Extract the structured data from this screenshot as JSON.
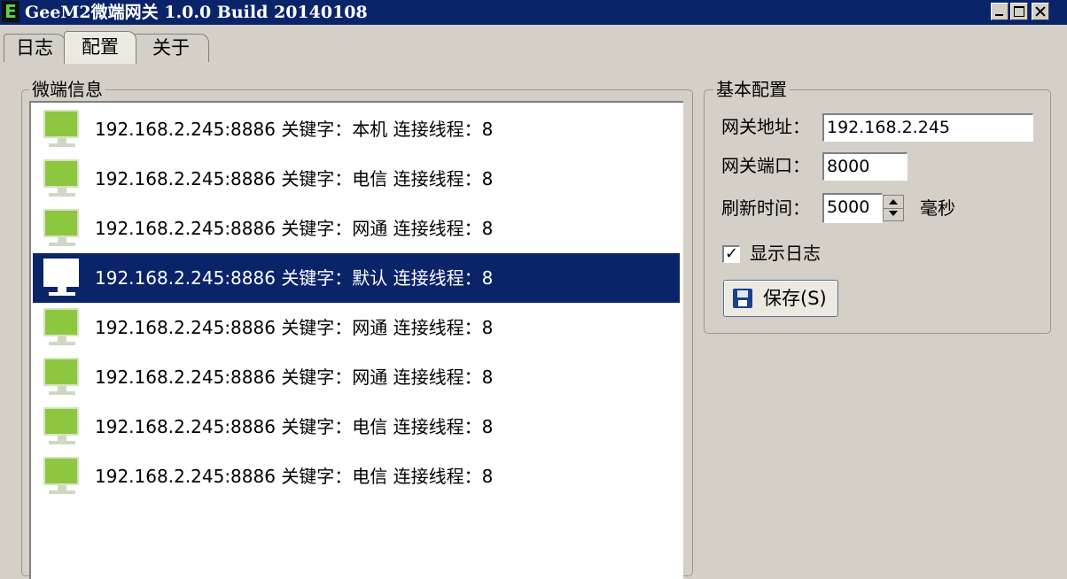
{
  "window": {
    "title": "GeeM2微端网关 1.0.0 Build 20140108",
    "icon_letter": "E"
  },
  "tabs": [
    {
      "label": "日志"
    },
    {
      "label": "配置",
      "selected": true
    },
    {
      "label": "关于"
    }
  ],
  "left_group": {
    "title": "微端信息",
    "items": [
      {
        "text": "192.168.2.245:8886 关键字：本机 连接线程：8",
        "selected": false
      },
      {
        "text": "192.168.2.245:8886 关键字：电信 连接线程：8",
        "selected": false
      },
      {
        "text": "192.168.2.245:8886 关键字：网通 连接线程：8",
        "selected": false
      },
      {
        "text": "192.168.2.245:8886 关键字：默认 连接线程：8",
        "selected": true
      },
      {
        "text": "192.168.2.245:8886 关键字：网通 连接线程：8",
        "selected": false
      },
      {
        "text": "192.168.2.245:8886 关键字：网通 连接线程：8",
        "selected": false
      },
      {
        "text": "192.168.2.245:8886 关键字：电信 连接线程：8",
        "selected": false
      },
      {
        "text": "192.168.2.245:8886 关键字：电信 连接线程：8",
        "selected": false
      }
    ]
  },
  "right_group": {
    "title": "基本配置",
    "gateway_address": {
      "label": "网关地址：",
      "value": "192.168.2.245"
    },
    "gateway_port": {
      "label": "网关端口：",
      "value": "8000"
    },
    "refresh_time": {
      "label": "刷新时间：",
      "value": "5000",
      "unit": "毫秒"
    },
    "show_log": {
      "label": "显示日志",
      "checked": true,
      "check_mark": "✓"
    },
    "save_button": {
      "label": "保存(S)"
    }
  },
  "colors": {
    "titlebar": "#0a246a",
    "selection": "#0a246a",
    "window_bg": "#d4d0c8",
    "monitor_green": "#8dc63f"
  }
}
